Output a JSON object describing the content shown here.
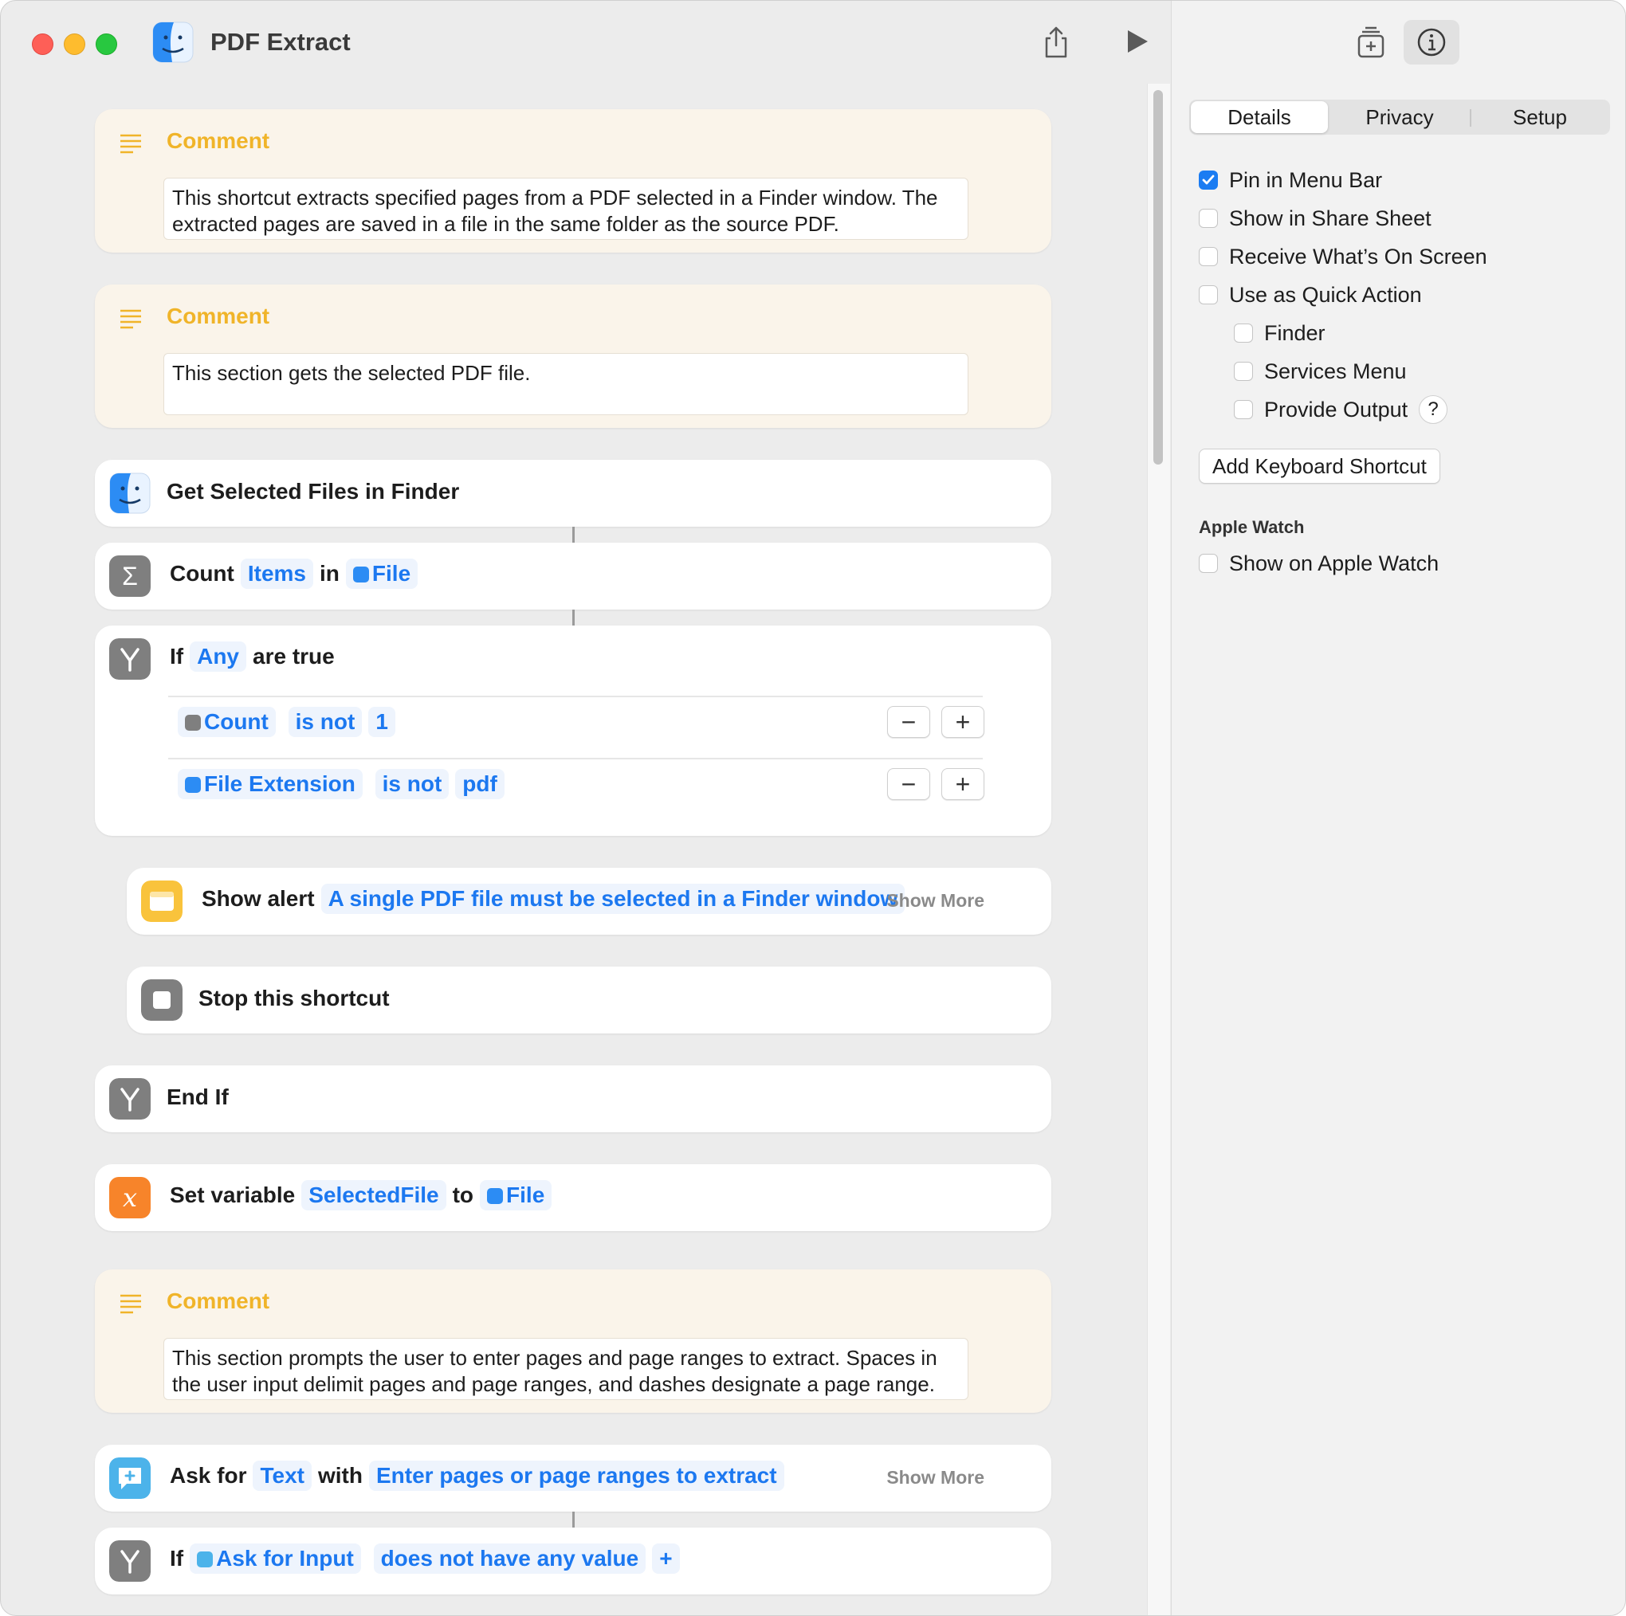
{
  "window": {
    "title": "PDF Extract"
  },
  "comments": [
    {
      "label": "Comment",
      "text": "This shortcut extracts specified pages from a PDF selected in a Finder window. The extracted pages are saved in a file in the same folder as the source PDF."
    },
    {
      "label": "Comment",
      "text": "This section gets the selected PDF file."
    },
    {
      "label": "Comment",
      "text": "This section prompts the user to enter pages and page ranges to extract. Spaces in the user input delimit pages and page ranges, and dashes designate a page range."
    }
  ],
  "actions": {
    "get_selected": {
      "title": "Get Selected Files in Finder"
    },
    "count": {
      "verb": "Count",
      "target": "Items",
      "prep": "in",
      "source": "File"
    },
    "if_any": {
      "verb": "If",
      "mode": "Any",
      "suffix": "are true",
      "conditions": [
        {
          "left": "Count",
          "op": "is not",
          "value": "1"
        },
        {
          "left": "File Extension",
          "op": "is not",
          "value": "pdf"
        }
      ],
      "minus": "−",
      "plus": "+"
    },
    "show_alert": {
      "verb": "Show alert",
      "message": "A single PDF file must be selected in a Finder window",
      "more": "Show More"
    },
    "stop": {
      "title": "Stop this shortcut"
    },
    "end_if": {
      "title": "End If"
    },
    "set_var": {
      "verb": "Set variable",
      "name": "SelectedFile",
      "prep": "to",
      "value": "File"
    },
    "ask_for": {
      "verb": "Ask for",
      "type": "Text",
      "prep": "with",
      "prompt": "Enter pages or page ranges to extract",
      "more": "Show More"
    },
    "if_value": {
      "verb": "If",
      "var": "Ask for Input",
      "cond": "does not have any value",
      "plus": "+"
    }
  },
  "sidebar": {
    "tabs": [
      "Details",
      "Privacy",
      "Setup"
    ],
    "active_tab": "Details",
    "options": [
      {
        "label": "Pin in Menu Bar",
        "checked": true
      },
      {
        "label": "Show in Share Sheet",
        "checked": false
      },
      {
        "label": "Receive What’s On Screen",
        "checked": false
      },
      {
        "label": "Use as Quick Action",
        "checked": false
      },
      {
        "label": "Finder",
        "checked": false
      },
      {
        "label": "Services Menu",
        "checked": false
      },
      {
        "label": "Provide Output",
        "checked": false
      }
    ],
    "help": "?",
    "keyboard_shortcut_button": "Add Keyboard Shortcut",
    "apple_watch_title": "Apple Watch",
    "apple_watch_option": {
      "label": "Show on Apple Watch",
      "checked": false
    }
  },
  "colors": {
    "accent_blue": "#1c78f0",
    "comment_bg": "#faf4ea",
    "comment_label": "#f0b429",
    "variable_orange": "#f7842a",
    "alert_yellow": "#f9c33c",
    "gray_icon": "#7f7f7f"
  },
  "icons": [
    "finder-icon",
    "share-icon",
    "play-icon",
    "add-to-library-icon",
    "info-icon",
    "comment-icon",
    "sigma-icon",
    "branch-icon",
    "alert-icon",
    "stop-icon",
    "variable-icon",
    "ask-icon"
  ]
}
